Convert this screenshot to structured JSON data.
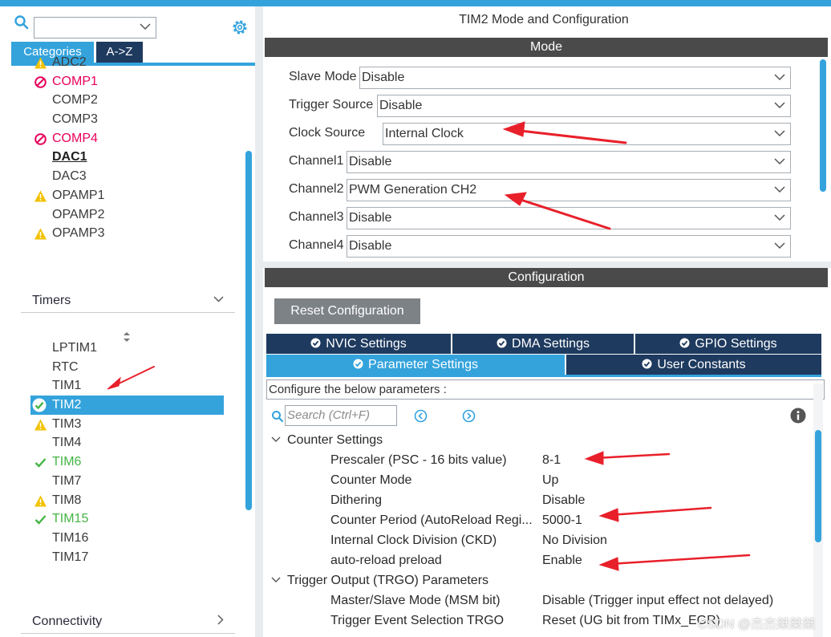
{
  "left_panel": {
    "search": {
      "value": ""
    },
    "category_tabs": [
      {
        "label": "Categories"
      },
      {
        "label": "A->Z"
      }
    ],
    "analog_items": [
      {
        "label": "ADC2",
        "status": "warning"
      },
      {
        "label": "COMP1",
        "status": "disabled"
      },
      {
        "label": "COMP2",
        "status": "none"
      },
      {
        "label": "COMP3",
        "status": "none"
      },
      {
        "label": "COMP4",
        "status": "disabled"
      },
      {
        "label": "DAC1",
        "status": "bold"
      },
      {
        "label": "DAC3",
        "status": "none"
      },
      {
        "label": "OPAMP1",
        "status": "warning"
      },
      {
        "label": "OPAMP2",
        "status": "none"
      },
      {
        "label": "OPAMP3",
        "status": "warning"
      }
    ],
    "timers_group": {
      "label": "Timers"
    },
    "timer_items": [
      {
        "label": "LPTIM1",
        "status": "none"
      },
      {
        "label": "RTC",
        "status": "none"
      },
      {
        "label": "TIM1",
        "status": "none"
      },
      {
        "label": "TIM2",
        "status": "selected"
      },
      {
        "label": "TIM3",
        "status": "warning"
      },
      {
        "label": "TIM4",
        "status": "none"
      },
      {
        "label": "TIM6",
        "status": "enabled"
      },
      {
        "label": "TIM7",
        "status": "none"
      },
      {
        "label": "TIM8",
        "status": "warning"
      },
      {
        "label": "TIM15",
        "status": "enabled"
      },
      {
        "label": "TIM16",
        "status": "none"
      },
      {
        "label": "TIM17",
        "status": "none"
      }
    ],
    "connectivity_group": {
      "label": "Connectivity"
    }
  },
  "right_panel": {
    "title": "TIM2 Mode and Configuration",
    "mode_header": "Mode",
    "mode_rows": [
      {
        "label": "Slave Mode",
        "value": "Disable"
      },
      {
        "label": "Trigger Source",
        "value": "Disable"
      },
      {
        "label": "Clock Source",
        "value": "Internal Clock"
      },
      {
        "label": "Channel1",
        "value": "Disable"
      },
      {
        "label": "Channel2",
        "value": "PWM Generation CH2"
      },
      {
        "label": "Channel3",
        "value": "Disable"
      },
      {
        "label": "Channel4",
        "value": "Disable"
      }
    ],
    "config_header": "Configuration",
    "reset_button": "Reset Configuration",
    "settings_tabs": {
      "nvic": "NVIC Settings",
      "dma": "DMA Settings",
      "gpio": "GPIO Settings",
      "parameter": "Parameter Settings",
      "user_constants": "User Constants"
    },
    "configure_text": "Configure the below parameters :",
    "param_search_placeholder": "Search (Ctrl+F)",
    "counter_section": "Counter Settings",
    "counter_params": [
      {
        "name": "Prescaler (PSC - 16 bits value)",
        "value": "8-1"
      },
      {
        "name": "Counter Mode",
        "value": "Up"
      },
      {
        "name": "Dithering",
        "value": "Disable"
      },
      {
        "name": "Counter Period (AutoReload Regi...",
        "value": "5000-1"
      },
      {
        "name": "Internal Clock Division (CKD)",
        "value": "No Division"
      },
      {
        "name": "auto-reload preload",
        "value": "Enable"
      }
    ],
    "trgo_section": "Trigger Output (TRGO) Parameters",
    "trgo_params": [
      {
        "name": "Master/Slave Mode (MSM bit)",
        "value": "Disable (Trigger input effect not delayed)"
      },
      {
        "name": "Trigger Event Selection TRGO",
        "value": "Reset (UG bit from TIMx_EGR)"
      }
    ]
  },
  "watermark": "CSDN @杰杰桀桀桀",
  "colors": {
    "accent": "#34a3dc",
    "dark_tab": "#1e3a5f",
    "band": "#4a4a4a",
    "disabled_pink": "#e8005a",
    "enabled_green": "#45b545",
    "warning_yellow": "#f2c200",
    "annotation_red": "#e8202a"
  }
}
